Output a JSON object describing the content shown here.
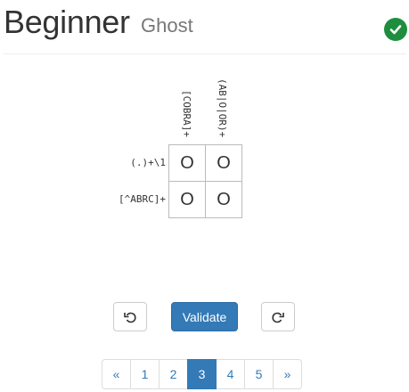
{
  "header": {
    "title": "Beginner",
    "subtitle": "Ghost",
    "solved_icon": "check-circle-icon",
    "solved_color": "#1e8e3e"
  },
  "puzzle": {
    "column_patterns": [
      "[COBRA]+",
      "(AB|O|OR)+"
    ],
    "row_patterns": [
      "(.)+\\1",
      "[^ABRC]+"
    ],
    "cells": [
      [
        "O",
        "O"
      ],
      [
        "O",
        "O"
      ]
    ]
  },
  "controls": {
    "undo_icon": "undo-icon",
    "validate_label": "Validate",
    "redo_icon": "redo-icon",
    "accent_color": "#337ab7"
  },
  "pagination": {
    "prev_label": "«",
    "pages": [
      "1",
      "2",
      "3",
      "4",
      "5"
    ],
    "active_page": "3",
    "next_label": "»"
  }
}
